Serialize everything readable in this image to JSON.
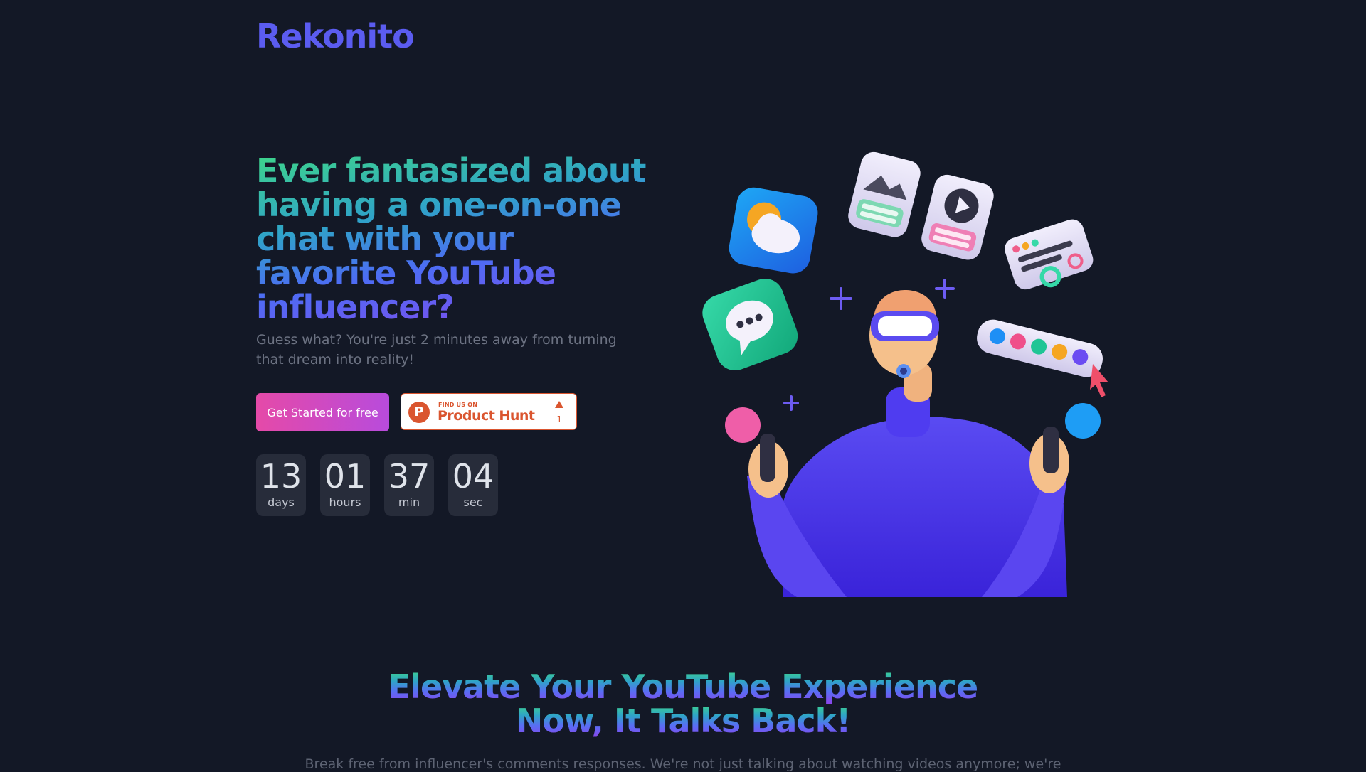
{
  "brand": {
    "name": "Rekonito"
  },
  "hero": {
    "title": "Ever fantasized about having a one-on-one chat with your favorite YouTube influencer?",
    "subtitle": "Guess what? You're just 2 minutes away from turning that dream into reality!",
    "cta_label": "Get Started for free"
  },
  "product_hunt": {
    "logo_letter": "P",
    "small_text": "FIND US ON",
    "name": "Product Hunt",
    "upvotes": "1"
  },
  "countdown": [
    {
      "value": "13",
      "unit": "days"
    },
    {
      "value": "01",
      "unit": "hours"
    },
    {
      "value": "37",
      "unit": "min"
    },
    {
      "value": "04",
      "unit": "sec"
    }
  ],
  "section": {
    "title_line1": "Elevate Your YouTube Experience",
    "title_line2": "Now, It Talks Back!",
    "subtitle": "Break free from influencer's comments responses. We're not just talking about watching videos anymore; we're"
  },
  "colors": {
    "background": "#131826",
    "brand": "#5b5cf0",
    "cta_start": "#e54aa8",
    "cta_end": "#b84bdc",
    "product_hunt": "#da552f"
  },
  "illustration": {
    "icons": [
      "weather-icon",
      "image-card-icon",
      "video-card-icon",
      "settings-card-icon",
      "chat-bubble-icon",
      "color-palette-icon",
      "cursor-icon",
      "plus-icon"
    ],
    "figure": "vr-person-illustration"
  }
}
